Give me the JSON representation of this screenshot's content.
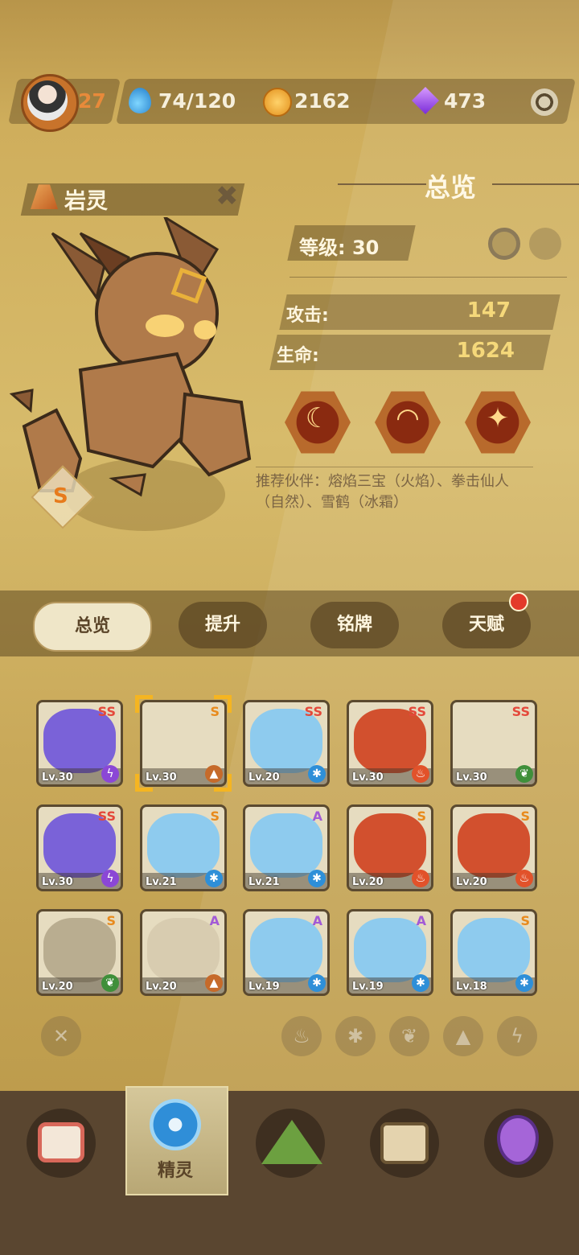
{
  "top": {
    "level": "27",
    "stamina": "74/120",
    "coins": "2162",
    "gems": "473"
  },
  "spirit": {
    "name": "岩灵",
    "rank": "S",
    "section_title": "总览",
    "level_text": "等级: 30",
    "attack_label": "攻击:",
    "attack": "147",
    "hp_label": "生命:",
    "hp": "1624",
    "partner_text": "推荐伙伴：熔焰三宝（火焰）、拳击仙人（自然）、雪鹤（冰霜）"
  },
  "tabs": [
    "总览",
    "提升",
    "铭牌",
    "天赋"
  ],
  "cards": [
    {
      "rank": "SS",
      "lv": "Lv.30",
      "elem": "thunder"
    },
    {
      "rank": "S",
      "lv": "Lv.30",
      "elem": "earth"
    },
    {
      "rank": "SS",
      "lv": "Lv.20",
      "elem": "ice"
    },
    {
      "rank": "SS",
      "lv": "Lv.30",
      "elem": "fire"
    },
    {
      "rank": "SS",
      "lv": "Lv.30",
      "elem": "nature"
    },
    {
      "rank": "SS",
      "lv": "Lv.30",
      "elem": "thunder"
    },
    {
      "rank": "S",
      "lv": "Lv.21",
      "elem": "ice"
    },
    {
      "rank": "A",
      "lv": "Lv.21",
      "elem": "ice"
    },
    {
      "rank": "S",
      "lv": "Lv.20",
      "elem": "fire"
    },
    {
      "rank": "S",
      "lv": "Lv.20",
      "elem": "fire"
    },
    {
      "rank": "S",
      "lv": "Lv.20",
      "elem": "nature"
    },
    {
      "rank": "A",
      "lv": "Lv.20",
      "elem": "earth"
    },
    {
      "rank": "A",
      "lv": "Lv.19",
      "elem": "ice"
    },
    {
      "rank": "A",
      "lv": "Lv.19",
      "elem": "ice"
    },
    {
      "rank": "S",
      "lv": "Lv.18",
      "elem": "ice"
    }
  ],
  "nav": {
    "active_label": "精灵"
  },
  "colors": {
    "ss": "#e4483a",
    "s": "#e88a1c",
    "a": "#a25ad6",
    "fire": "#e2522a",
    "ice": "#2e8fd8",
    "nature": "#3f8f3a",
    "thunder": "#8b47d6",
    "earth": "#c66a2a"
  }
}
